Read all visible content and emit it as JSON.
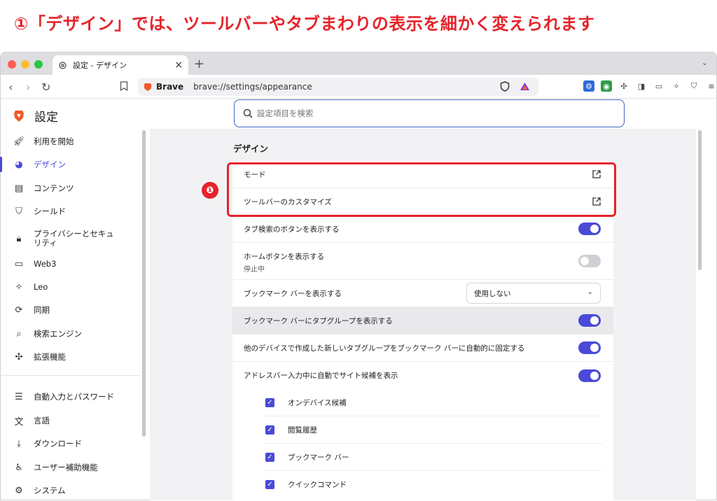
{
  "headline": "①「デザイン」では、ツールバーやタブまわりの表示を細かく変えられます",
  "tab": {
    "title": "設定 - デザイン",
    "close": "×"
  },
  "newtab": "+",
  "tabmenu": "⌄",
  "toolbar": {
    "back": "‹",
    "forward": "›",
    "reload": "↻",
    "url_brand": "Brave",
    "url": "brave://settings/appearance"
  },
  "brand": {
    "title": "設定"
  },
  "sidebar": {
    "items": [
      {
        "label": "利用を開始",
        "icon": "rocket-icon"
      },
      {
        "label": "デザイン",
        "icon": "palette-icon",
        "active": true
      },
      {
        "label": "コンテンツ",
        "icon": "content-icon"
      },
      {
        "label": "シールド",
        "icon": "shield-icon"
      },
      {
        "label": "プライバシーとセキュリティ",
        "icon": "lock-icon"
      },
      {
        "label": "Web3",
        "icon": "wallet-icon"
      },
      {
        "label": "Leo",
        "icon": "sparkle-icon"
      },
      {
        "label": "同期",
        "icon": "sync-icon"
      },
      {
        "label": "検索エンジン",
        "icon": "search-icon"
      },
      {
        "label": "拡張機能",
        "icon": "puzzle-icon"
      },
      {
        "label": "自動入力とパスワード",
        "icon": "list-icon"
      },
      {
        "label": "言語",
        "icon": "translate-icon"
      },
      {
        "label": "ダウンロード",
        "icon": "download-icon"
      },
      {
        "label": "ユーザー補助機能",
        "icon": "accessibility-icon"
      },
      {
        "label": "システム",
        "icon": "gear-icon"
      }
    ]
  },
  "search": {
    "placeholder": "設定項目を検索"
  },
  "main": {
    "section_title": "デザイン",
    "rows": [
      {
        "label": "モード"
      },
      {
        "label": "ツールバーのカスタマイズ"
      },
      {
        "label": "タブ検索のボタンを表示する"
      },
      {
        "label": "ホームボタンを表示する",
        "sub": "停止中"
      },
      {
        "label": "ブックマーク バーを表示する",
        "select": "使用しない"
      },
      {
        "label": "ブックマーク バーにタブグループを表示する"
      },
      {
        "label": "他のデバイスで作成した新しいタブグループをブックマーク バーに自動的に固定する"
      },
      {
        "label": "アドレスバー入力中に自動でサイト候補を表示"
      }
    ],
    "sub_rows": [
      {
        "label": "オンデバイス候補"
      },
      {
        "label": "閲覧履歴"
      },
      {
        "label": "ブックマーク バー"
      },
      {
        "label": "クイックコマンド"
      }
    ]
  },
  "annotation": {
    "number": "❶"
  },
  "colors": {
    "accent": "#4a4ad8",
    "annotation_red": "#e5232a"
  }
}
